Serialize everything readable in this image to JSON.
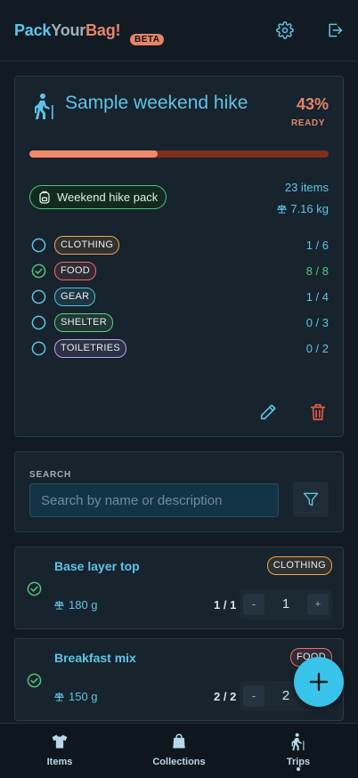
{
  "app": {
    "logo_pack": "Pack",
    "logo_your": "Your",
    "logo_bag": "Bag!",
    "beta": "BETA"
  },
  "header": {
    "settings_icon": "gear-icon",
    "logout_icon": "logout-icon"
  },
  "trip": {
    "title": "Sample weekend hike",
    "percent_label": "43%",
    "ready_label": "READY",
    "progress": 0.43,
    "pack_name": "Weekend hike pack",
    "items_count": "23 items",
    "weight": "7.16 kg",
    "categories": [
      {
        "name": "CLOTHING",
        "count": "1 / 6",
        "done": false,
        "color": "#f2a24a"
      },
      {
        "name": "FOOD",
        "count": "8 / 8",
        "done": true,
        "color": "#ef6b6b"
      },
      {
        "name": "GEAR",
        "count": "1 / 4",
        "done": false,
        "color": "#4fbfe0"
      },
      {
        "name": "SHELTER",
        "count": "0 / 3",
        "done": false,
        "color": "#5fd07f"
      },
      {
        "name": "TOILETRIES",
        "count": "0 / 2",
        "done": false,
        "color": "#c89af0"
      }
    ]
  },
  "search": {
    "label": "SEARCH",
    "placeholder": "Search by name or description"
  },
  "items": [
    {
      "name": "Base layer top",
      "category": "CLOTHING",
      "category_color": "#f2a24a",
      "weight": "180 g",
      "ratio": "1 / 1",
      "quantity": "1",
      "minus": "-",
      "plus": "+"
    },
    {
      "name": "Breakfast mix",
      "category": "FOOD",
      "category_color": "#ef6b6b",
      "weight": "150 g",
      "ratio": "2 / 2",
      "quantity": "2",
      "minus": "-",
      "plus": "+"
    }
  ],
  "nav": {
    "items": "Items",
    "collections": "Collections",
    "trips": "Trips"
  },
  "colors": {
    "accent": "#38c3ea",
    "brand_orange": "#e4856a",
    "success": "#4ec77a",
    "background": "#121b23"
  }
}
